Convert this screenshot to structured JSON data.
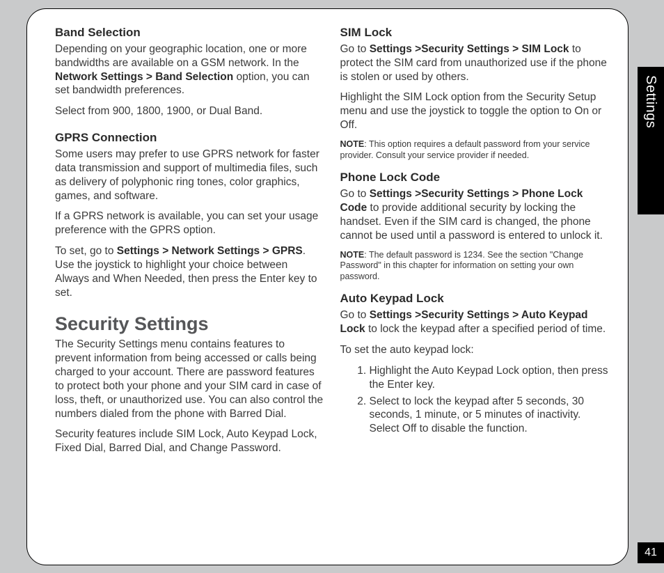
{
  "sideTab": "Settings",
  "pageNumber": "41",
  "left": {
    "band": {
      "h": "Band Selection",
      "p1a": "Depending on your geographic location, one or more bandwidths are available on a GSM network. In the ",
      "p1b": "Network Settings > Band Selection",
      "p1c": " option, you can set bandwidth preferences.",
      "p2": "Select from 900, 1800, 1900, or Dual Band."
    },
    "gprs": {
      "h": "GPRS Connection",
      "p1": "Some users may prefer to use GPRS network for faster data transmission and support of multimedia files, such as delivery of polyphonic ring tones, color graphics, games, and software.",
      "p2": "If a GPRS network is available, you can set your usage preference with the GPRS option.",
      "p3a": "To set, go to ",
      "p3b": "Settings > Network Settings > GPRS",
      "p3c": ". Use the joystick to highlight your choice between Always and When Needed, then press the Enter key to set."
    },
    "sec": {
      "h": "Security Settings",
      "p1": "The Security Settings menu contains features to prevent information from being accessed or calls being charged to your account. There are password features to protect both your phone and your SIM card in case of loss, theft, or unauthorized use. You can also control the numbers dialed from the phone with Barred Dial.",
      "p2": "Security features include SIM Lock, Auto Keypad Lock, Fixed Dial, Barred Dial, and Change Password."
    }
  },
  "right": {
    "sim": {
      "h": "SIM Lock",
      "p1a": "Go to ",
      "p1b": "Settings >Security Settings > SIM Lock",
      "p1c": " to protect the SIM card from unauthorized use if the phone is stolen or used by others.",
      "p2": "Highlight the SIM Lock option from the Security Setup menu and use the joystick to toggle the option to On or Off.",
      "noteLabel": "NOTE",
      "note": ": This option requires a default password from your service provider. Consult your service provider if needed."
    },
    "plc": {
      "h": "Phone Lock Code",
      "p1a": "Go to ",
      "p1b": "Settings >Security Settings > Phone Lock Code",
      "p1c": " to provide additional security by locking the handset. Even if the SIM card is changed, the phone cannot be used until a password is entered to unlock it.",
      "noteLabel": "NOTE",
      "note": ": The default password is 1234. See the section \"Change Password\" in this chapter for information on setting your own password."
    },
    "akl": {
      "h": "Auto Keypad Lock",
      "p1a": "Go to ",
      "p1b": "Settings >Security Settings > Auto Keypad Lock",
      "p1c": " to lock the keypad after a specified period of time.",
      "p2": "To set the auto keypad lock:",
      "li1": "Highlight the Auto Keypad Lock option, then press the Enter key.",
      "li2": "Select to lock the keypad after 5 seconds, 30 seconds, 1 minute, or 5 minutes of inactivity. Select Off to disable the function."
    }
  }
}
